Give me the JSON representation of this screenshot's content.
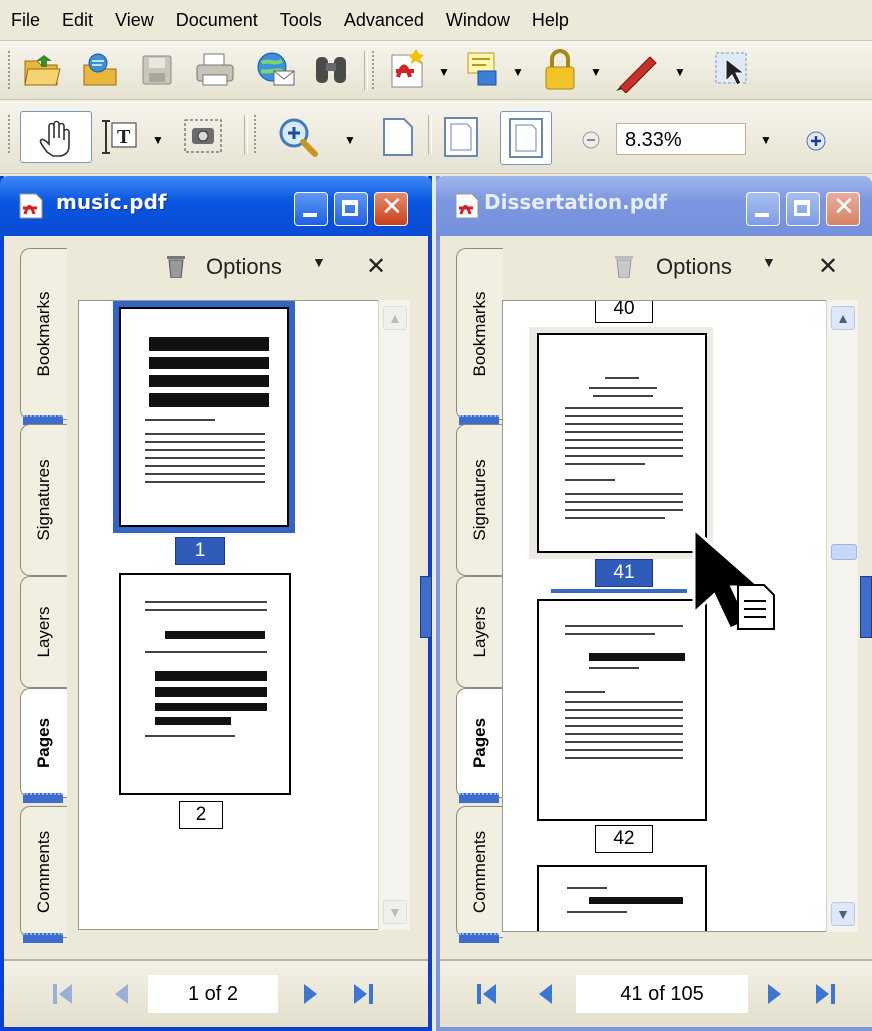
{
  "menu": [
    "File",
    "Edit",
    "View",
    "Document",
    "Tools",
    "Advanced",
    "Window",
    "Help"
  ],
  "toolbar": {
    "icons_row1": [
      "open-folder-icon",
      "organizer-icon",
      "save-icon",
      "print-icon",
      "email-icon",
      "search-binoculars-icon",
      "create-pdf-icon",
      "comment-icon",
      "secure-lock-icon",
      "sign-pen-icon",
      "select-arrow-icon"
    ],
    "icons_row2": [
      "hand-tool-icon",
      "select-text-icon",
      "snapshot-icon",
      "zoom-in-icon",
      "actual-size-icon",
      "fit-page-icon",
      "fit-width-icon",
      "zoom-out-icon",
      "zoom-plus-icon"
    ],
    "zoom": "8.33%"
  },
  "windows": {
    "left": {
      "title": "music.pdf",
      "options": "Options",
      "tabs": [
        "Bookmarks",
        "Signatures",
        "Layers",
        "Pages",
        "Comments"
      ],
      "active_tab": "Pages",
      "pages": [
        "1",
        "2"
      ],
      "selected_page": "1",
      "nav_text": "1 of 2"
    },
    "right": {
      "title": "Dissertation.pdf",
      "options": "Options",
      "tabs": [
        "Bookmarks",
        "Signatures",
        "Layers",
        "Pages",
        "Comments"
      ],
      "active_tab": "Pages",
      "pages": [
        "40",
        "41",
        "42"
      ],
      "selected_page": "41",
      "nav_text": "41 of 105"
    }
  },
  "colors": {
    "accent": "#0a4ad2",
    "selection": "#3366c4",
    "chrome": "#ece9d8"
  }
}
